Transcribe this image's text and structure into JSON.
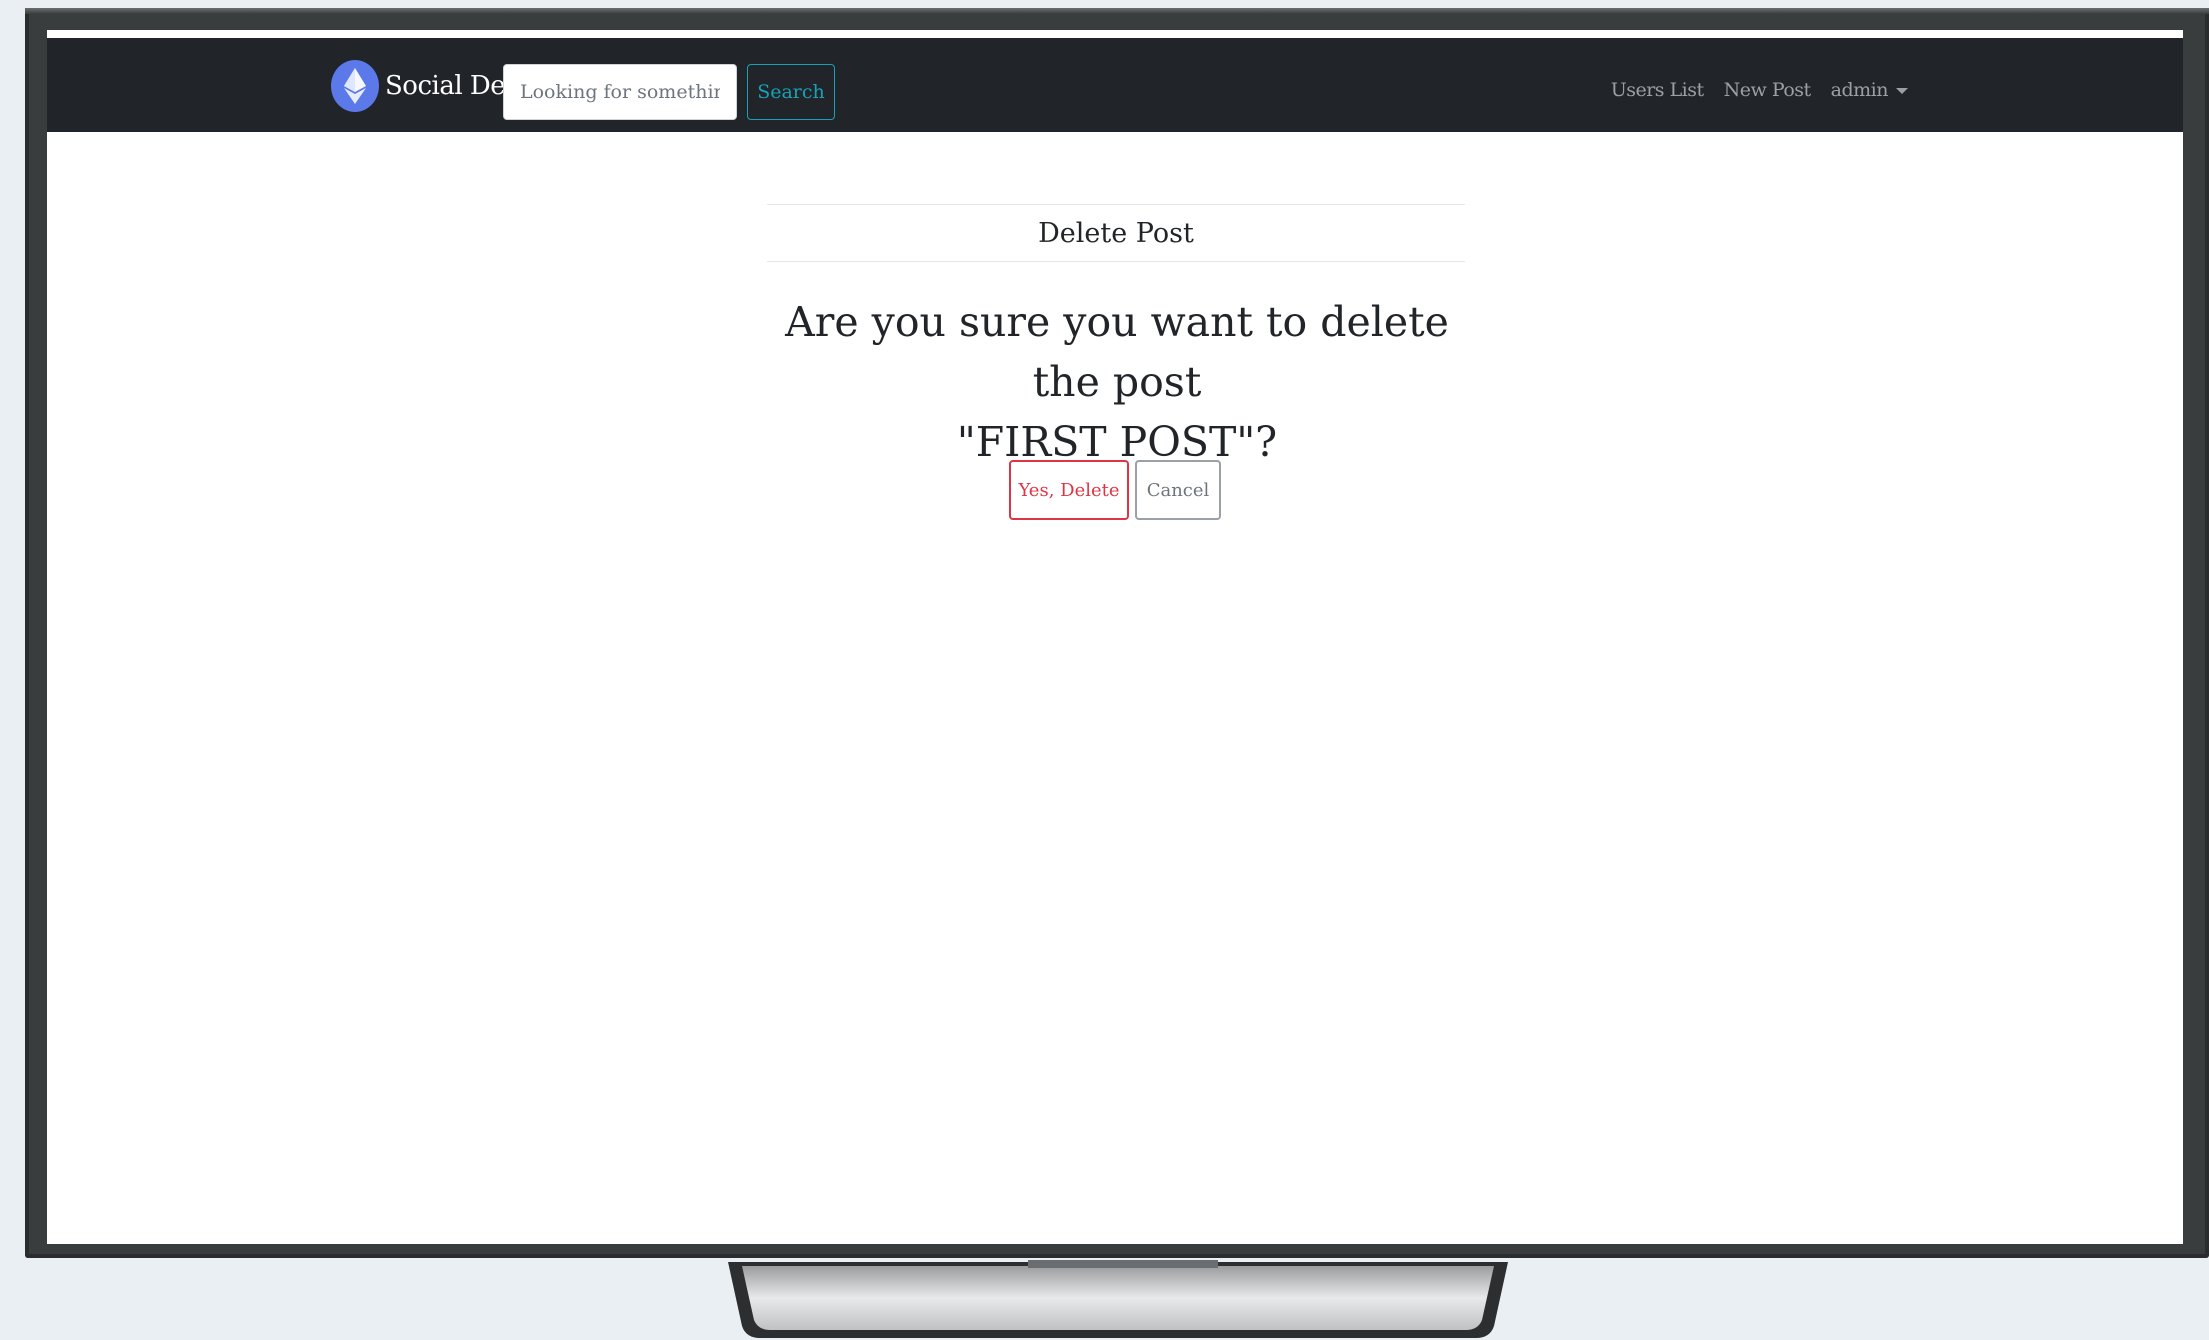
{
  "navbar": {
    "brand": "Social Dex",
    "search_placeholder": "Looking for something?",
    "search_button": "Search",
    "links": [
      "Users List",
      "New Post"
    ],
    "user_menu": "admin"
  },
  "main": {
    "header": "Delete Post",
    "question_line1": "Are you sure you want to delete the post",
    "question_line2": "\"FIRST POST\"?",
    "confirm_button": "Yes, Delete",
    "cancel_button": "Cancel"
  }
}
